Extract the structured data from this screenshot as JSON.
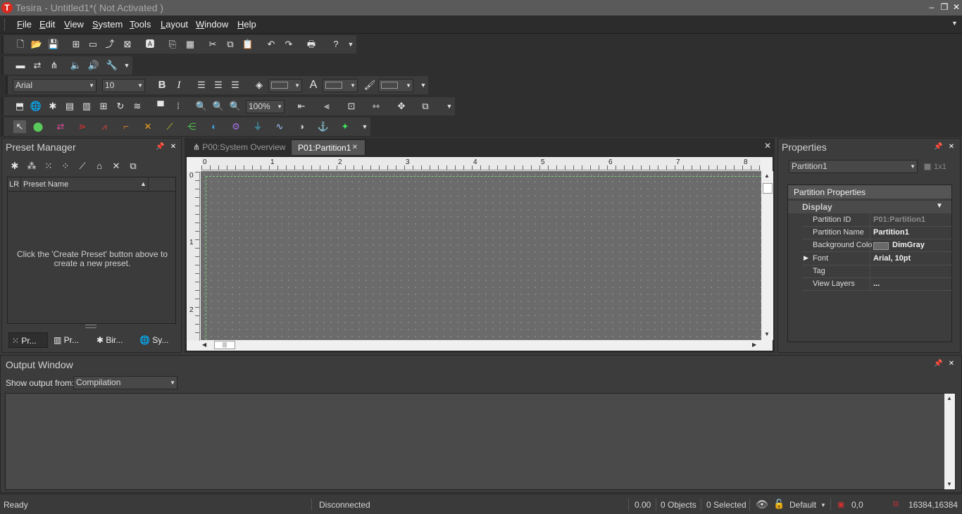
{
  "window": {
    "title": "Tesira - Untitled1*( Not Activated )",
    "logo_letter": "T"
  },
  "menu": [
    "File",
    "Edit",
    "View",
    "System",
    "Tools",
    "Layout",
    "Window",
    "Help"
  ],
  "toolbar": {
    "font_name": "Arial",
    "font_size": "10",
    "zoom": "100%",
    "bold": "B",
    "italic": "I",
    "text_glyph": "A"
  },
  "preset_manager": {
    "title": "Preset Manager",
    "col_lr": "LR",
    "col_name": "Preset Name",
    "empty_line1": "Click the 'Create Preset' button above to",
    "empty_line2": "create a new preset.",
    "tabs": [
      "Pr...",
      "Pr...",
      "Bir...",
      "Sy..."
    ]
  },
  "documents": {
    "tabs": [
      {
        "label": "P00:System Overview",
        "active": false
      },
      {
        "label": "P01:Partition1",
        "active": true
      }
    ],
    "ruler_h": [
      "0",
      "1",
      "2",
      "3",
      "4",
      "5",
      "6",
      "7",
      "8"
    ],
    "ruler_v": [
      "0",
      "1",
      "2"
    ]
  },
  "properties": {
    "title": "Properties",
    "selector": "Partition1",
    "layout": "1x1",
    "section": "Partition Properties",
    "category": "Display",
    "rows": [
      {
        "name": "Partition ID",
        "value": "P01:Partition1"
      },
      {
        "name": "Partition Name",
        "value": "Partition1"
      },
      {
        "name": "Background Colo",
        "value": "DimGray"
      },
      {
        "name": "Font",
        "value": "Arial, 10pt"
      },
      {
        "name": "Tag",
        "value": ""
      },
      {
        "name": "View Layers",
        "value": "..."
      }
    ],
    "colors": {
      "dimgray": "#696969"
    }
  },
  "output": {
    "title": "Output Window",
    "show_label": "Show output from:",
    "source": "Compilation"
  },
  "status": {
    "ready": "Ready",
    "connection": "Disconnected",
    "value": "0.00",
    "objects": "0 Objects",
    "selected": "0 Selected",
    "layer": "Default",
    "pos": "0,0",
    "size": "16384,16384"
  }
}
